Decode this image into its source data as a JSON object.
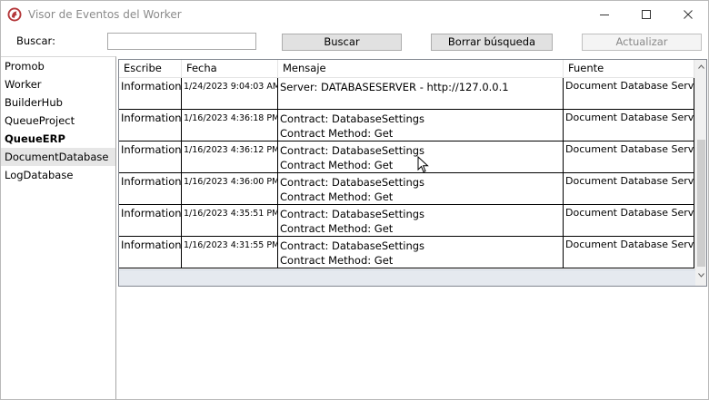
{
  "window": {
    "title": "Visor de Eventos del Worker",
    "accent_color": "#b4373a"
  },
  "toolbar": {
    "search_label": "Buscar:",
    "search_value": "",
    "search_button": "Buscar",
    "clear_button": "Borrar búsqueda",
    "refresh_button": "Actualizar",
    "refresh_disabled": true
  },
  "sidebar": {
    "items": [
      {
        "label": "Promob"
      },
      {
        "label": "Worker"
      },
      {
        "label": "BuilderHub"
      },
      {
        "label": "QueueProject"
      },
      {
        "label": "QueueERP",
        "bold": true
      },
      {
        "label": "DocumentDatabase",
        "selected": true
      },
      {
        "label": "LogDatabase"
      }
    ]
  },
  "grid": {
    "columns": [
      "Escribe",
      "Fecha",
      "Mensaje",
      "Fuente"
    ],
    "rows": [
      {
        "type": "Information",
        "date": "1/24/2023 9:04:03 AM",
        "message": [
          "Server: DATABASESERVER - http://127.0.0.1"
        ],
        "source": "Document Database Service"
      },
      {
        "type": "Information",
        "date": "1/16/2023 4:36:18 PM",
        "message": [
          "Contract: DatabaseSettings",
          "Contract Method: Get"
        ],
        "source": "Document Database Service"
      },
      {
        "type": "Information",
        "date": "1/16/2023 4:36:12 PM",
        "message": [
          "Contract: DatabaseSettings",
          "Contract Method: Get"
        ],
        "source": "Document Database Service"
      },
      {
        "type": "Information",
        "date": "1/16/2023 4:36:00 PM",
        "message": [
          "Contract: DatabaseSettings",
          "Contract Method: Get"
        ],
        "source": "Document Database Service"
      },
      {
        "type": "Information",
        "date": "1/16/2023 4:35:51 PM",
        "message": [
          "Contract: DatabaseSettings",
          "Contract Method: Get"
        ],
        "source": "Document Database Service"
      },
      {
        "type": "Information",
        "date": "1/16/2023 4:31:55 PM",
        "message": [
          "Contract: DatabaseSettings",
          "Contract Method: Get"
        ],
        "source": "Document Database Service"
      }
    ]
  }
}
